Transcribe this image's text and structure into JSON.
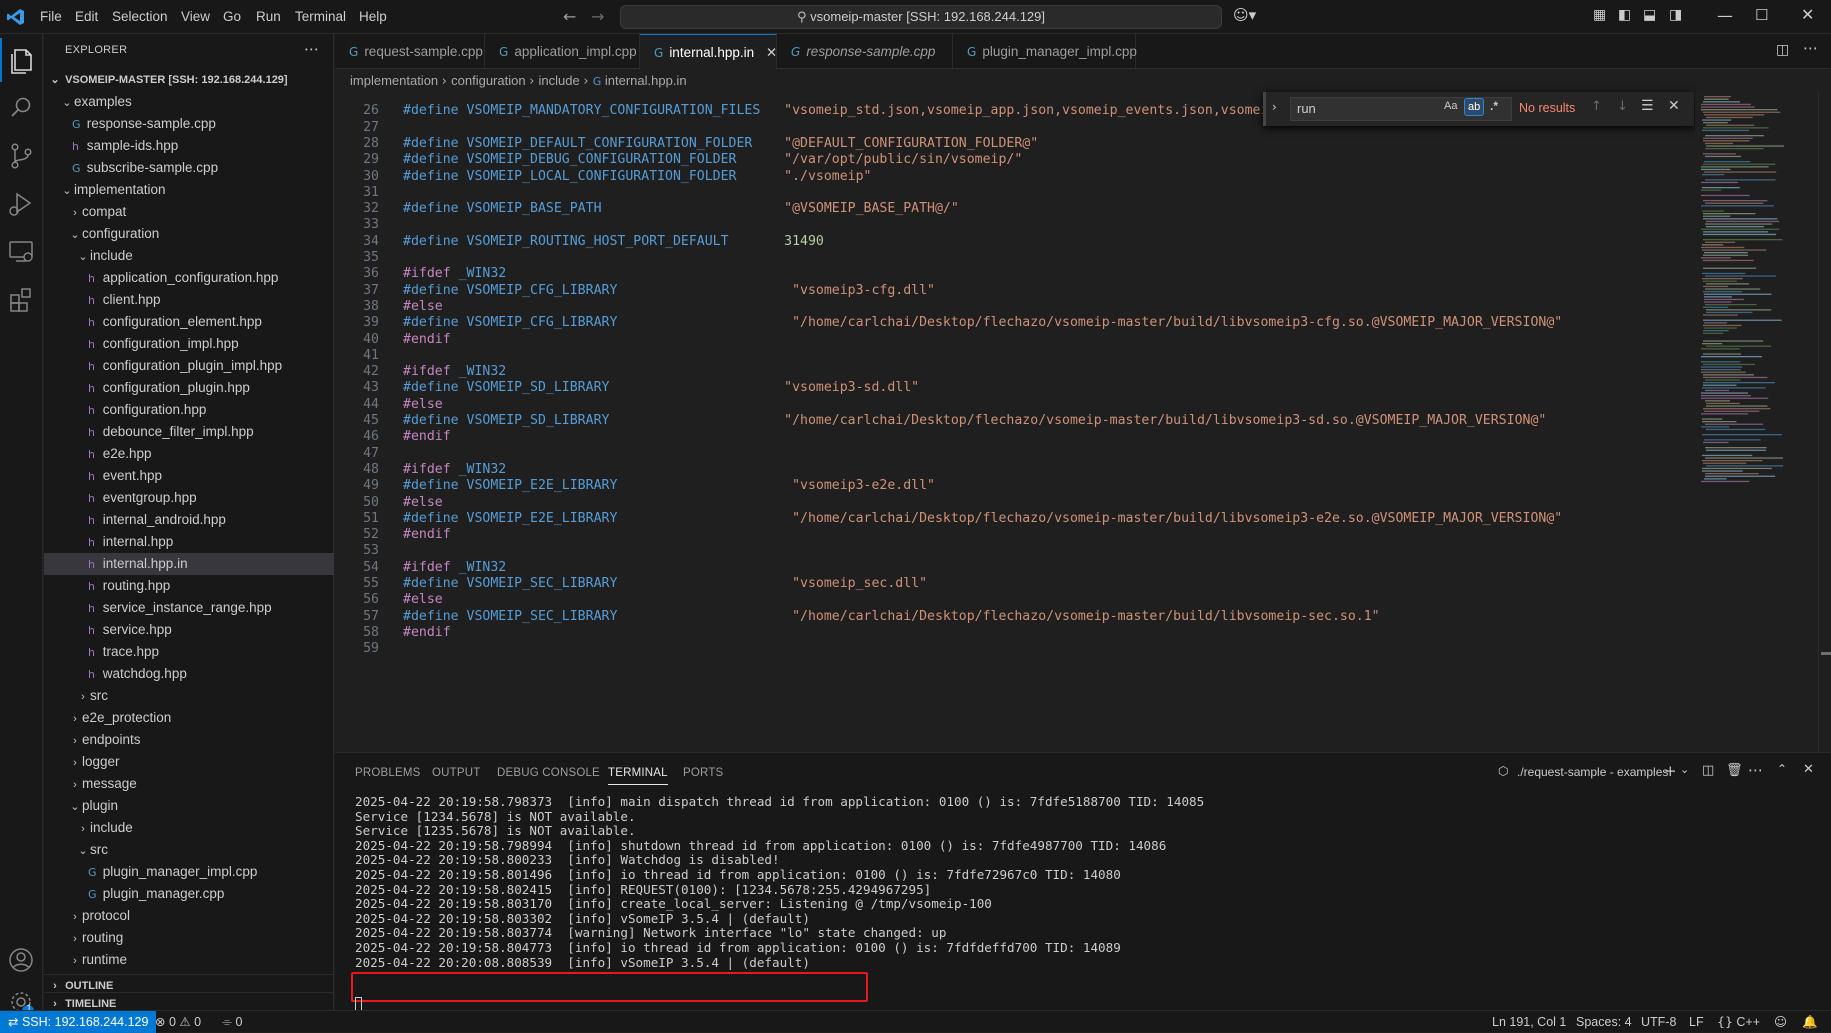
{
  "titlebar": {
    "menus": [
      "File",
      "Edit",
      "Selection",
      "View",
      "Go",
      "Run",
      "Terminal",
      "Help"
    ],
    "command_center": "vsomeip-master [SSH: 192.168.244.129]"
  },
  "sidebar": {
    "header": "EXPLORER",
    "root": "VSOMEIP-MASTER [SSH: 192.168.244.129]",
    "items": [
      {
        "label": "examples",
        "depth": 1,
        "kind": "folder-open"
      },
      {
        "label": "response-sample.cpp",
        "depth": 2,
        "kind": "cpp"
      },
      {
        "label": "sample-ids.hpp",
        "depth": 2,
        "kind": "hpp"
      },
      {
        "label": "subscribe-sample.cpp",
        "depth": 2,
        "kind": "cpp"
      },
      {
        "label": "implementation",
        "depth": 1,
        "kind": "folder-open"
      },
      {
        "label": "compat",
        "depth": 2,
        "kind": "folder"
      },
      {
        "label": "configuration",
        "depth": 2,
        "kind": "folder-open"
      },
      {
        "label": "include",
        "depth": 3,
        "kind": "folder-open"
      },
      {
        "label": "application_configuration.hpp",
        "depth": 4,
        "kind": "hpp"
      },
      {
        "label": "client.hpp",
        "depth": 4,
        "kind": "hpp"
      },
      {
        "label": "configuration_element.hpp",
        "depth": 4,
        "kind": "hpp"
      },
      {
        "label": "configuration_impl.hpp",
        "depth": 4,
        "kind": "hpp"
      },
      {
        "label": "configuration_plugin_impl.hpp",
        "depth": 4,
        "kind": "hpp"
      },
      {
        "label": "configuration_plugin.hpp",
        "depth": 4,
        "kind": "hpp"
      },
      {
        "label": "configuration.hpp",
        "depth": 4,
        "kind": "hpp"
      },
      {
        "label": "debounce_filter_impl.hpp",
        "depth": 4,
        "kind": "hpp"
      },
      {
        "label": "e2e.hpp",
        "depth": 4,
        "kind": "hpp"
      },
      {
        "label": "event.hpp",
        "depth": 4,
        "kind": "hpp"
      },
      {
        "label": "eventgroup.hpp",
        "depth": 4,
        "kind": "hpp"
      },
      {
        "label": "internal_android.hpp",
        "depth": 4,
        "kind": "hpp"
      },
      {
        "label": "internal.hpp",
        "depth": 4,
        "kind": "hpp"
      },
      {
        "label": "internal.hpp.in",
        "depth": 4,
        "kind": "hpp",
        "selected": true
      },
      {
        "label": "routing.hpp",
        "depth": 4,
        "kind": "hpp"
      },
      {
        "label": "service_instance_range.hpp",
        "depth": 4,
        "kind": "hpp"
      },
      {
        "label": "service.hpp",
        "depth": 4,
        "kind": "hpp"
      },
      {
        "label": "trace.hpp",
        "depth": 4,
        "kind": "hpp"
      },
      {
        "label": "watchdog.hpp",
        "depth": 4,
        "kind": "hpp"
      },
      {
        "label": "src",
        "depth": 3,
        "kind": "folder"
      },
      {
        "label": "e2e_protection",
        "depth": 2,
        "kind": "folder"
      },
      {
        "label": "endpoints",
        "depth": 2,
        "kind": "folder"
      },
      {
        "label": "logger",
        "depth": 2,
        "kind": "folder"
      },
      {
        "label": "message",
        "depth": 2,
        "kind": "folder"
      },
      {
        "label": "plugin",
        "depth": 2,
        "kind": "folder-open"
      },
      {
        "label": "include",
        "depth": 3,
        "kind": "folder"
      },
      {
        "label": "src",
        "depth": 3,
        "kind": "folder-open"
      },
      {
        "label": "plugin_manager_impl.cpp",
        "depth": 4,
        "kind": "cpp"
      },
      {
        "label": "plugin_manager.cpp",
        "depth": 4,
        "kind": "cpp"
      },
      {
        "label": "protocol",
        "depth": 2,
        "kind": "folder"
      },
      {
        "label": "routing",
        "depth": 2,
        "kind": "folder"
      },
      {
        "label": "runtime",
        "depth": 2,
        "kind": "folder"
      }
    ],
    "outline": "OUTLINE",
    "timeline": "TIMELINE"
  },
  "tabs": [
    {
      "label": "request-sample.cpp",
      "active": false,
      "italic": false
    },
    {
      "label": "application_impl.cpp",
      "active": false,
      "italic": false
    },
    {
      "label": "internal.hpp.in",
      "active": true,
      "italic": false
    },
    {
      "label": "response-sample.cpp",
      "active": false,
      "italic": true
    },
    {
      "label": "plugin_manager_impl.cpp",
      "active": false,
      "italic": false
    }
  ],
  "breadcrumb": [
    "implementation",
    "configuration",
    "include",
    "internal.hpp.in"
  ],
  "find": {
    "value": "run",
    "status": "No results",
    "case_label": "Aa",
    "word_label": "ab",
    "regex_label": ".*"
  },
  "editor_lines": [
    {
      "n": "26",
      "parts": [
        [
          "mac",
          "#define "
        ],
        [
          "mac",
          "VSOMEIP_MANDATORY_CONFIGURATION_FILES"
        ],
        [
          "plain",
          "   "
        ],
        [
          "str",
          "\"vsomeip_std.json,vsomeip_app.json,vsomeip_events.json,vsomeip_p"
        ]
      ]
    },
    {
      "n": "27",
      "parts": []
    },
    {
      "n": "28",
      "parts": [
        [
          "mac",
          "#define "
        ],
        [
          "mac",
          "VSOMEIP_DEFAULT_CONFIGURATION_FOLDER"
        ],
        [
          "plain",
          "    "
        ],
        [
          "str",
          "\"@DEFAULT_CONFIGURATION_FOLDER@\""
        ]
      ]
    },
    {
      "n": "29",
      "parts": [
        [
          "mac",
          "#define "
        ],
        [
          "mac",
          "VSOMEIP_DEBUG_CONFIGURATION_FOLDER"
        ],
        [
          "plain",
          "      "
        ],
        [
          "str",
          "\"/var/opt/public/sin/vsomeip/\""
        ]
      ]
    },
    {
      "n": "30",
      "parts": [
        [
          "mac",
          "#define "
        ],
        [
          "mac",
          "VSOMEIP_LOCAL_CONFIGURATION_FOLDER"
        ],
        [
          "plain",
          "      "
        ],
        [
          "str",
          "\"./vsomeip\""
        ]
      ]
    },
    {
      "n": "31",
      "parts": []
    },
    {
      "n": "32",
      "parts": [
        [
          "mac",
          "#define "
        ],
        [
          "mac",
          "VSOMEIP_BASE_PATH"
        ],
        [
          "plain",
          "                       "
        ],
        [
          "str",
          "\"@VSOMEIP_BASE_PATH@/\""
        ]
      ]
    },
    {
      "n": "33",
      "parts": []
    },
    {
      "n": "34",
      "parts": [
        [
          "mac",
          "#define "
        ],
        [
          "mac",
          "VSOMEIP_ROUTING_HOST_PORT_DEFAULT"
        ],
        [
          "plain",
          "       "
        ],
        [
          "num",
          "31490"
        ]
      ]
    },
    {
      "n": "35",
      "parts": []
    },
    {
      "n": "36",
      "parts": [
        [
          "kw",
          "#ifdef "
        ],
        [
          "mac",
          "_WIN32"
        ]
      ]
    },
    {
      "n": "37",
      "parts": [
        [
          "mac",
          "#define "
        ],
        [
          "mac",
          "VSOMEIP_CFG_LIBRARY"
        ],
        [
          "plain",
          "                      "
        ],
        [
          "str",
          "\"vsomeip3-cfg.dll\""
        ]
      ]
    },
    {
      "n": "38",
      "parts": [
        [
          "kw",
          "#else"
        ]
      ]
    },
    {
      "n": "39",
      "parts": [
        [
          "mac",
          "#define "
        ],
        [
          "mac",
          "VSOMEIP_CFG_LIBRARY"
        ],
        [
          "plain",
          "                      "
        ],
        [
          "str",
          "\"/home/carlchai/Desktop/flechazo/vsomeip-master/build/libvsomeip3-cfg.so.@VSOMEIP_MAJOR_VERSION@\""
        ]
      ]
    },
    {
      "n": "40",
      "parts": [
        [
          "kw",
          "#endif"
        ]
      ]
    },
    {
      "n": "41",
      "parts": []
    },
    {
      "n": "42",
      "parts": [
        [
          "kw",
          "#ifdef "
        ],
        [
          "mac",
          "_WIN32"
        ]
      ]
    },
    {
      "n": "43",
      "parts": [
        [
          "mac",
          "#define "
        ],
        [
          "mac",
          "VSOMEIP_SD_LIBRARY"
        ],
        [
          "plain",
          "                      "
        ],
        [
          "str",
          "\"vsomeip3-sd.dll\""
        ]
      ]
    },
    {
      "n": "44",
      "parts": [
        [
          "kw",
          "#else"
        ]
      ]
    },
    {
      "n": "45",
      "parts": [
        [
          "mac",
          "#define "
        ],
        [
          "mac",
          "VSOMEIP_SD_LIBRARY"
        ],
        [
          "plain",
          "                      "
        ],
        [
          "str",
          "\"/home/carlchai/Desktop/flechazo/vsomeip-master/build/libvsomeip3-sd.so.@VSOMEIP_MAJOR_VERSION@\""
        ]
      ]
    },
    {
      "n": "46",
      "parts": [
        [
          "kw",
          "#endif"
        ]
      ]
    },
    {
      "n": "47",
      "parts": []
    },
    {
      "n": "48",
      "parts": [
        [
          "kw",
          "#ifdef "
        ],
        [
          "mac",
          "_WIN32"
        ]
      ]
    },
    {
      "n": "49",
      "parts": [
        [
          "mac",
          "#define "
        ],
        [
          "mac",
          "VSOMEIP_E2E_LIBRARY"
        ],
        [
          "plain",
          "                      "
        ],
        [
          "str",
          "\"vsomeip3-e2e.dll\""
        ]
      ]
    },
    {
      "n": "50",
      "parts": [
        [
          "kw",
          "#else"
        ]
      ]
    },
    {
      "n": "51",
      "parts": [
        [
          "mac",
          "#define "
        ],
        [
          "mac",
          "VSOMEIP_E2E_LIBRARY"
        ],
        [
          "plain",
          "                      "
        ],
        [
          "str",
          "\"/home/carlchai/Desktop/flechazo/vsomeip-master/build/libvsomeip3-e2e.so.@VSOMEIP_MAJOR_VERSION@\""
        ]
      ]
    },
    {
      "n": "52",
      "parts": [
        [
          "kw",
          "#endif"
        ]
      ]
    },
    {
      "n": "53",
      "parts": []
    },
    {
      "n": "54",
      "parts": [
        [
          "kw",
          "#ifdef "
        ],
        [
          "mac",
          "_WIN32"
        ]
      ]
    },
    {
      "n": "55",
      "parts": [
        [
          "mac",
          "#define "
        ],
        [
          "mac",
          "VSOMEIP_SEC_LIBRARY"
        ],
        [
          "plain",
          "                      "
        ],
        [
          "str",
          "\"vsomeip_sec.dll\""
        ]
      ]
    },
    {
      "n": "56",
      "parts": [
        [
          "kw",
          "#else"
        ]
      ]
    },
    {
      "n": "57",
      "parts": [
        [
          "mac",
          "#define "
        ],
        [
          "mac",
          "VSOMEIP_SEC_LIBRARY"
        ],
        [
          "plain",
          "                      "
        ],
        [
          "str",
          "\"/home/carlchai/Desktop/flechazo/vsomeip-master/build/libvsomeip-sec.so.1\""
        ]
      ]
    },
    {
      "n": "58",
      "parts": [
        [
          "kw",
          "#endif"
        ]
      ]
    },
    {
      "n": "59",
      "parts": []
    }
  ],
  "panel": {
    "tabs": [
      "PROBLEMS",
      "OUTPUT",
      "DEBUG CONSOLE",
      "TERMINAL",
      "PORTS"
    ],
    "active_tab": "TERMINAL",
    "terminal_name": "./request-sample - examples",
    "lines": [
      "2025-04-22 20:19:58.798373  [info] main dispatch thread id from application: 0100 () is: 7fdfe5188700 TID: 14085",
      "Service [1234.5678] is NOT available.",
      "Service [1235.5678] is NOT available.",
      "2025-04-22 20:19:58.798994  [info] shutdown thread id from application: 0100 () is: 7fdfe4987700 TID: 14086",
      "2025-04-22 20:19:58.800233  [info] Watchdog is disabled!",
      "2025-04-22 20:19:58.801496  [info] io thread id from application: 0100 () is: 7fdfe72967c0 TID: 14080",
      "2025-04-22 20:19:58.802415  [info] REQUEST(0100): [1234.5678:255.4294967295]",
      "2025-04-22 20:19:58.803170  [info] create_local_server: Listening @ /tmp/vsomeip-100",
      "2025-04-22 20:19:58.803302  [info] vSomeIP 3.5.4 | (default)",
      "2025-04-22 20:19:58.803774  [warning] Network interface \"lo\" state changed: up",
      "2025-04-22 20:19:58.804773  [info] io thread id from application: 0100 () is: 7fdfdeffd700 TID: 14089",
      "2025-04-22 20:20:08.808539  [info] vSomeIP 3.5.4 | (default)"
    ]
  },
  "statusbar": {
    "remote": "SSH: 192.168.244.129",
    "errors": "0",
    "warnings": "0",
    "ports": "0",
    "position": "Ln 191, Col 1",
    "spaces": "Spaces: 4",
    "encoding": "UTF-8",
    "eol": "LF",
    "language": "C++",
    "notification_count": "1"
  },
  "colors": {
    "accent": "#0078d4",
    "highlight_box": "#e5191f",
    "bg": "#1f1f1f"
  }
}
